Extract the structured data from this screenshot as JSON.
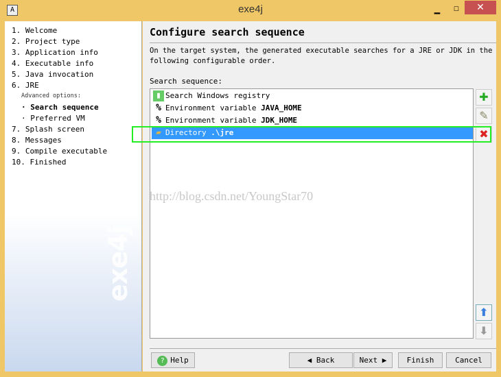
{
  "window": {
    "title": "exe4j",
    "minimize": "▁",
    "maximize": "☐",
    "close": "✕"
  },
  "sidebar": {
    "steps": [
      "1. Welcome",
      "2. Project type",
      "3. Application info",
      "4. Executable info",
      "5. Java invocation",
      "6. JRE"
    ],
    "advanced_label": "Advanced options:",
    "sub_items": [
      "· Search sequence",
      "· Preferred VM"
    ],
    "active_sub": "Search sequence",
    "steps_after": [
      "7. Splash screen",
      "8. Messages",
      "9. Compile executable",
      "10. Finished"
    ],
    "logo": "exe4j"
  },
  "main": {
    "heading": "Configure search sequence",
    "description": "On the target system, the generated executable searches for a JRE or JDK in the following configurable order.",
    "sequence_label": "Search sequence:",
    "items": [
      {
        "icon": "registry-icon",
        "prefix": "Search Windows registry",
        "value": ""
      },
      {
        "icon": "percent-icon",
        "prefix": "Environment variable ",
        "value": "JAVA_HOME"
      },
      {
        "icon": "percent-icon",
        "prefix": "Environment variable ",
        "value": "JDK_HOME"
      },
      {
        "icon": "folder-icon",
        "prefix": "Directory ",
        "value": ".\\jre",
        "selected": true
      }
    ],
    "watermark": "http://blog.csdn.net/YoungStar70"
  },
  "buttons": {
    "help": "Help",
    "back": "Back",
    "next": "Next",
    "finish": "Finish",
    "cancel": "Cancel"
  },
  "colors": {
    "window_border": "#f0c766",
    "selection": "#3399ff",
    "highlight": "#22ee22",
    "close": "#c75050"
  }
}
